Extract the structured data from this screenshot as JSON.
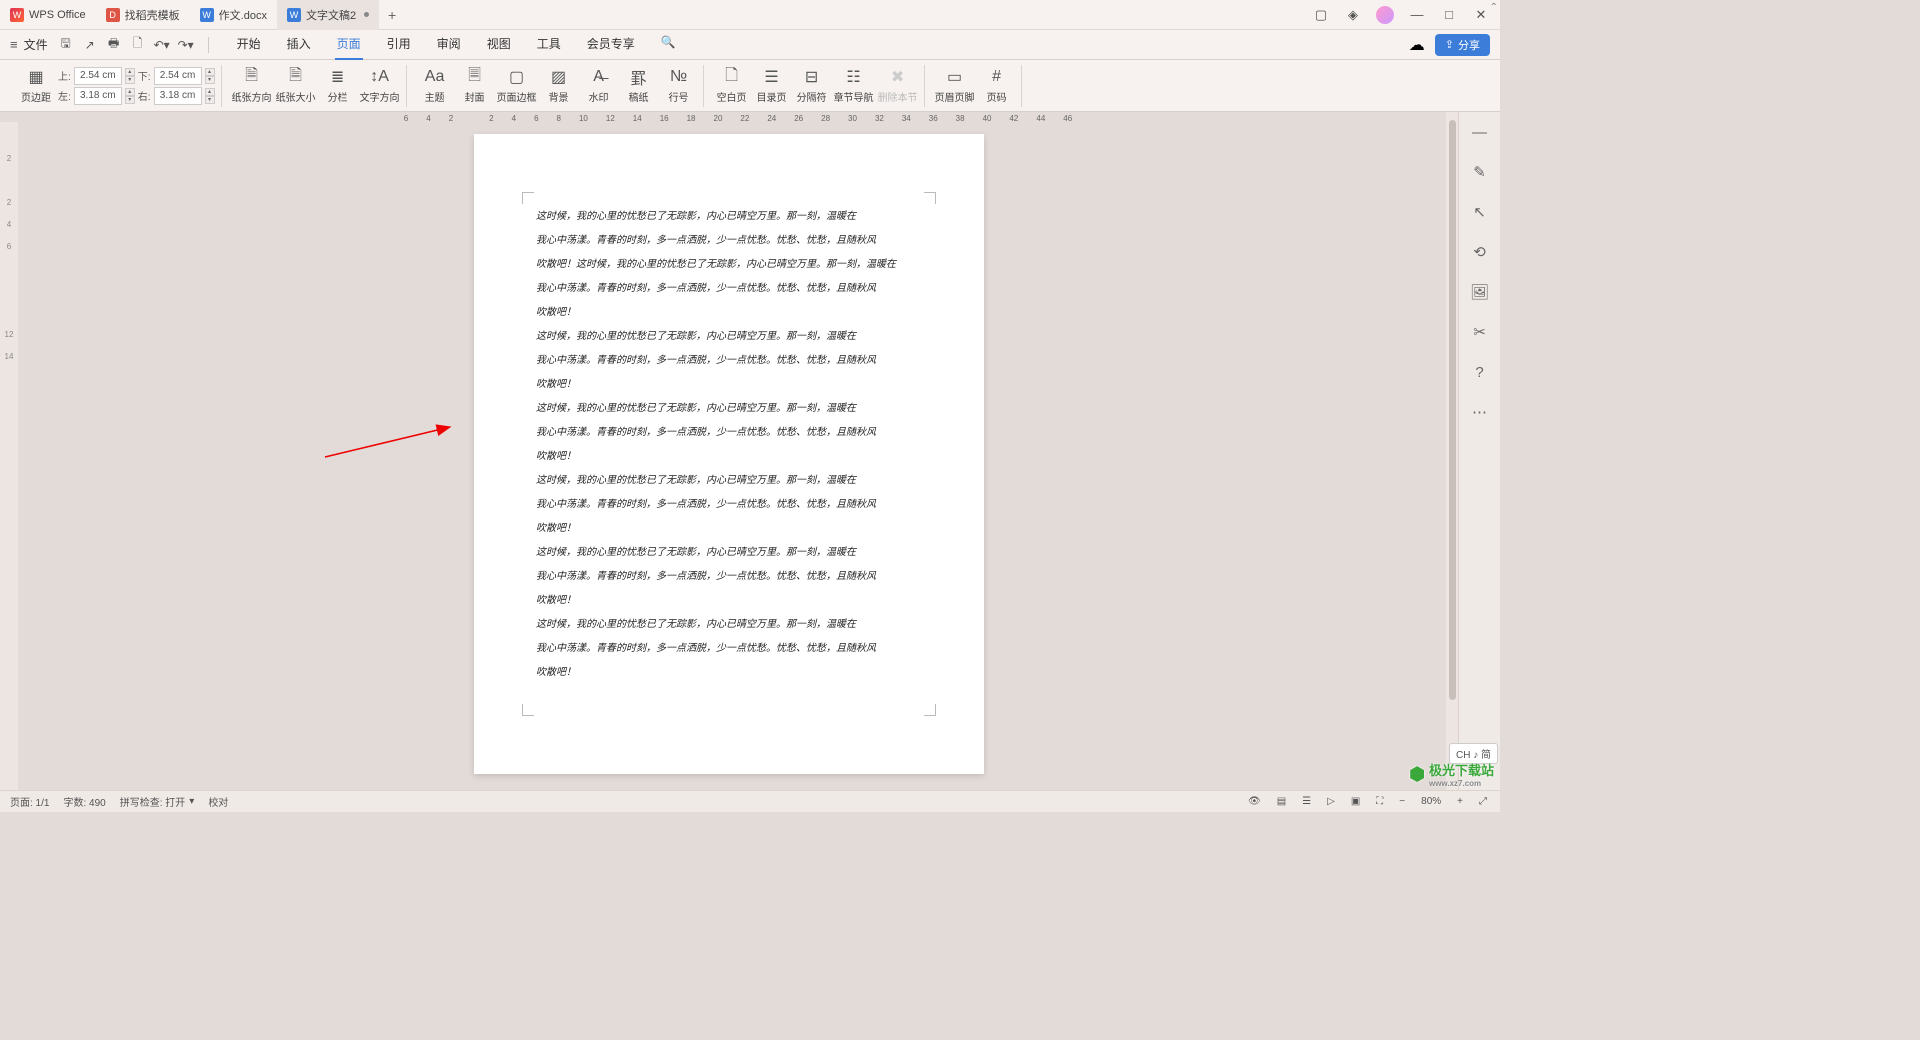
{
  "tabs": [
    {
      "label": "WPS Office",
      "icon": "wps"
    },
    {
      "label": "找稻壳模板",
      "icon": "d"
    },
    {
      "label": "作文.docx",
      "icon": "doc"
    },
    {
      "label": "文字文稿2",
      "icon": "doc",
      "active": true,
      "modified": true
    }
  ],
  "titlebar_icons": [
    "restore",
    "cube",
    "avatar",
    "min",
    "max",
    "close"
  ],
  "file_label": "文件",
  "menutabs": [
    {
      "label": "开始"
    },
    {
      "label": "插入"
    },
    {
      "label": "页面",
      "active": true
    },
    {
      "label": "引用"
    },
    {
      "label": "审阅"
    },
    {
      "label": "视图"
    },
    {
      "label": "工具"
    },
    {
      "label": "会员专享"
    }
  ],
  "share_label": "分享",
  "margins": {
    "top_label": "上:",
    "top_value": "2.54",
    "top_unit": "cm",
    "bottom_label": "下:",
    "bottom_value": "2.54",
    "bottom_unit": "cm",
    "left_label": "左:",
    "left_value": "3.18",
    "left_unit": "cm",
    "right_label": "右:",
    "right_value": "3.18",
    "right_unit": "cm"
  },
  "ribbon": {
    "margin": "页边距",
    "orient": "纸张方向",
    "size": "纸张大小",
    "columns": "分栏",
    "textdir": "文字方向",
    "theme": "主题",
    "cover": "封面",
    "border": "页面边框",
    "background": "背景",
    "watermark": "水印",
    "manuscript": "稿纸",
    "linenum": "行号",
    "blank": "空白页",
    "toc": "目录页",
    "break": "分隔符",
    "chapnav": "章节导航",
    "delsection": "删除本节",
    "headerfooter": "页眉页脚",
    "pagenum": "页码"
  },
  "ruler_h": [
    "6",
    "4",
    "2",
    "",
    "2",
    "4",
    "6",
    "8",
    "10",
    "12",
    "14",
    "16",
    "18",
    "20",
    "22",
    "24",
    "26",
    "28",
    "30",
    "32",
    "34",
    "36",
    "38",
    "40",
    "42",
    "44",
    "46"
  ],
  "ruler_v": [
    "",
    "2",
    "",
    "2",
    "4",
    "6",
    "",
    "",
    "",
    "12",
    "14",
    "",
    "",
    "",
    "",
    "",
    "",
    "",
    "",
    "",
    "",
    "",
    "",
    "",
    ""
  ],
  "document_paragraphs": [
    "这时候，我的心里的忧愁已了无踪影，内心已晴空万里。那一刻，温暖在",
    "我心中荡漾。青春的时刻，多一点洒脱，少一点忧愁。忧愁、忧愁，且随秋风",
    "吹散吧！这时候，我的心里的忧愁已了无踪影，内心已晴空万里。那一刻，温暖在",
    "我心中荡漾。青春的时刻，多一点洒脱，少一点忧愁。忧愁、忧愁，且随秋风",
    "吹散吧！",
    "这时候，我的心里的忧愁已了无踪影，内心已晴空万里。那一刻，温暖在",
    "我心中荡漾。青春的时刻，多一点洒脱，少一点忧愁。忧愁、忧愁，且随秋风",
    "吹散吧！",
    "这时候，我的心里的忧愁已了无踪影，内心已晴空万里。那一刻，温暖在",
    "我心中荡漾。青春的时刻，多一点洒脱，少一点忧愁。忧愁、忧愁，且随秋风",
    "吹散吧！",
    "这时候，我的心里的忧愁已了无踪影，内心已晴空万里。那一刻，温暖在",
    "我心中荡漾。青春的时刻，多一点洒脱，少一点忧愁。忧愁、忧愁，且随秋风",
    "吹散吧！",
    "这时候，我的心里的忧愁已了无踪影，内心已晴空万里。那一刻，温暖在",
    "我心中荡漾。青春的时刻，多一点洒脱，少一点忧愁。忧愁、忧愁，且随秋风",
    "吹散吧！",
    "这时候，我的心里的忧愁已了无踪影，内心已晴空万里。那一刻，温暖在",
    "我心中荡漾。青春的时刻，多一点洒脱，少一点忧愁。忧愁、忧愁，且随秋风",
    "吹散吧！"
  ],
  "status": {
    "page": "页面: 1/1",
    "words": "字数: 490",
    "spell": "拼写检查: 打开",
    "proof": "校对",
    "zoom": "80%"
  },
  "ime": "CH ♪ 简",
  "watermark": {
    "main": "极光下载站",
    "sub": "www.xz7.com"
  }
}
